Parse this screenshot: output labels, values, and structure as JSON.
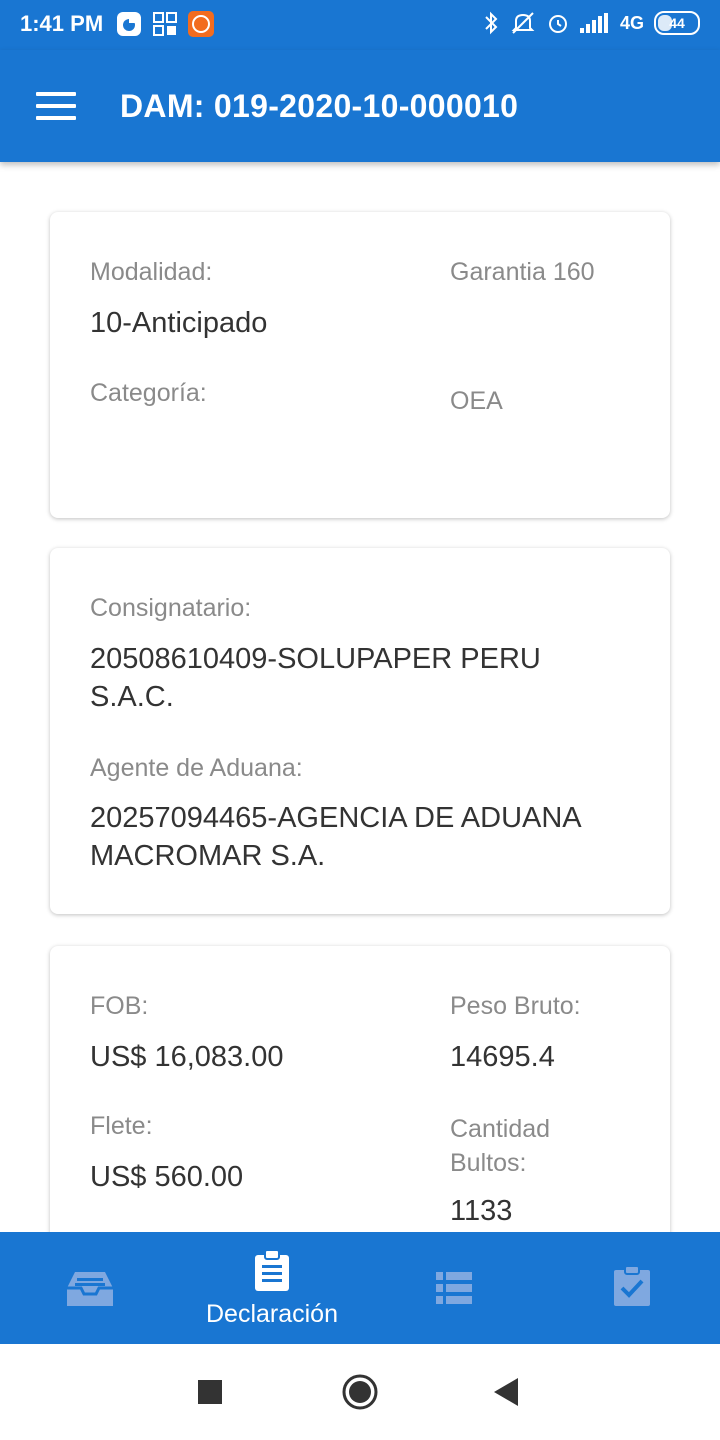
{
  "status_bar": {
    "time": "1:41 PM",
    "network": "4G",
    "battery": "44"
  },
  "app_bar": {
    "title": "DAM: 019-2020-10-000010"
  },
  "card1": {
    "modalidad_label": "Modalidad:",
    "modalidad_value": "10-Anticipado",
    "garantia": "Garantia 160",
    "categoria_label": "Categoría:",
    "categoria_value": "OEA"
  },
  "card2": {
    "consignatario_label": "Consignatario:",
    "consignatario_value": "20508610409-SOLUPAPER PERU S.A.C.",
    "agente_label": "Agente de Aduana:",
    "agente_value": "20257094465-AGENCIA DE ADUANA MACROMAR S.A."
  },
  "card3": {
    "fob_label": "FOB:",
    "fob_value": "US$ 16,083.00",
    "peso_label": "Peso Bruto:",
    "peso_value": "14695.4",
    "flete_label": "Flete:",
    "flete_value": "US$ 560.00",
    "bultos_label": "Cantidad Bultos:",
    "bultos_value": "1133"
  },
  "bottom_nav": {
    "items": [
      {
        "icon": "inbox-icon",
        "label": ""
      },
      {
        "icon": "clipboard-icon",
        "label": "Declaración",
        "active": true
      },
      {
        "icon": "list-icon",
        "label": ""
      },
      {
        "icon": "clipboard-check-icon",
        "label": ""
      }
    ]
  },
  "colors": {
    "primary": "#1976d2",
    "inactive_icon": "#7fa8e0"
  }
}
